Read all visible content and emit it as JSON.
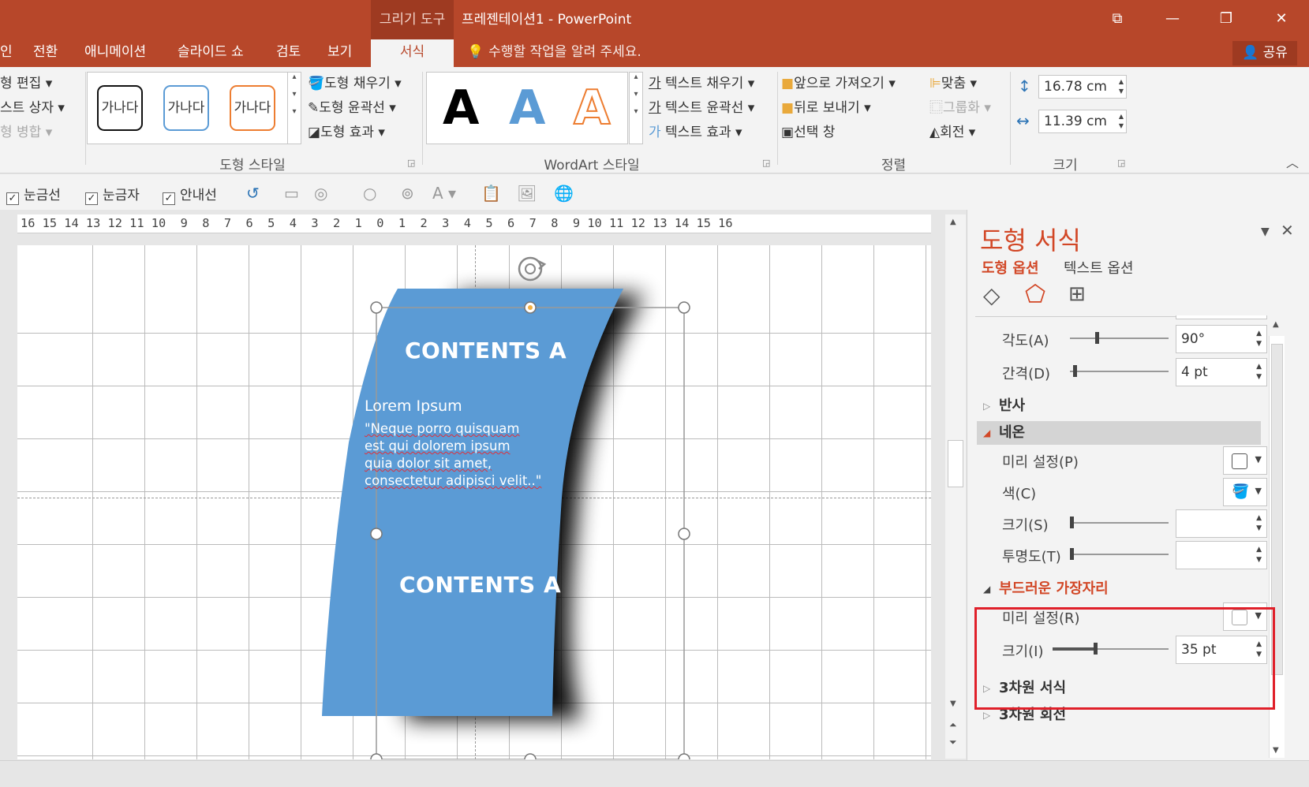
{
  "window": {
    "context_tool": "그리기 도구",
    "title": "프레젠테이션1 - PowerPoint",
    "controls": {
      "restore_ribbon": "⧉",
      "minimize": "—",
      "maximize": "❐",
      "close": "✕"
    }
  },
  "tabs": [
    {
      "label": "인",
      "active": false
    },
    {
      "label": "전환",
      "active": false
    },
    {
      "label": "애니메이션",
      "active": false
    },
    {
      "label": "슬라이드 쇼",
      "active": false
    },
    {
      "label": "검토",
      "active": false
    },
    {
      "label": "보기",
      "active": false
    },
    {
      "label": "서식",
      "active": true
    }
  ],
  "tell_me": "수행할 작업을 알려 주세요.",
  "share": "공유",
  "ribbon": {
    "insert_shapes": {
      "edit_shape": "형 편집",
      "text_box": "스트 상자",
      "merge_shapes": "형 병합"
    },
    "shape_styles": {
      "presets": [
        "가나다",
        "가나다",
        "가나다"
      ],
      "fill": "도형 채우기",
      "outline": "도형 윤곽선",
      "effects": "도형 효과",
      "group_label": "도형 스타일"
    },
    "wordart": {
      "letters": [
        "A",
        "A",
        "A"
      ],
      "text_fill": "텍스트 채우기",
      "text_outline": "텍스트 윤곽선",
      "text_effects": "텍스트 효과",
      "group_label": "WordArt 스타일"
    },
    "arrange": {
      "bring_forward": "앞으로 가져오기",
      "send_backward": "뒤로 보내기",
      "selection_pane": "선택 창",
      "align": "맞춤",
      "group": "그룹화",
      "rotate": "회전",
      "group_label": "정렬"
    },
    "size": {
      "height": "16.78 cm",
      "width": "11.39 cm",
      "group_label": "크기"
    }
  },
  "quick_toolbar": {
    "gridlines": "눈금선",
    "ruler": "눈금자",
    "guides": "안내선"
  },
  "ruler_text": "16 15 14 13 12 11 10  9  8  7  6  5  4  3  2  1  0  1  2  3  4  5  6  7  8  9 10 11 12 13 14 15 16",
  "slide": {
    "title_top": "CONTENTS A",
    "body_heading": "Lorem Ipsum",
    "body_lines": [
      "\"Neque porro quisquam",
      "est qui dolorem ipsum",
      "quia dolor sit amet,",
      "consectetur adipisci velit..\""
    ],
    "title_bottom": "CONTENTS A",
    "fill_color": "#5b9bd5",
    "shadow_color": "#000000"
  },
  "format_pane": {
    "title": "도형 서식",
    "tab_shape": "도형 옵션",
    "tab_text": "텍스트 옵션",
    "shadow": {
      "angle_label": "각도(A)",
      "angle_value": "90°",
      "distance_label": "간격(D)",
      "distance_value": "4 pt"
    },
    "reflection": "반사",
    "glow": {
      "label": "네온",
      "presets_label": "미리 설정(P)",
      "color_label": "색(C)",
      "size_label": "크기(S)",
      "size_value": "",
      "transparency_label": "투명도(T)",
      "transparency_value": ""
    },
    "soft_edges": {
      "label": "부드러운 가장자리",
      "presets_label": "미리 설정(R)",
      "size_label": "크기(I)",
      "size_value": "35 pt"
    },
    "format_3d": "3차원 서식",
    "rotation_3d": "3차원 회전"
  },
  "colors": {
    "accent": "#b7472a",
    "pane_title": "#d24726",
    "highlight": "#e0202a"
  }
}
